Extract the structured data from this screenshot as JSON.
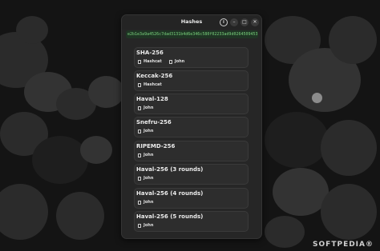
{
  "window": {
    "title": "Hashes"
  },
  "controls": {
    "info": "i",
    "minimize": "–",
    "maximize": "□",
    "close": "✕"
  },
  "hash_value": "e2b1e3a9a4526c7dad3131b4d6e346c580f02233ad9d0264509453",
  "results": [
    {
      "algorithm": "SHA-256",
      "tools": [
        "Hashcat",
        "John"
      ]
    },
    {
      "algorithm": "Keccak-256",
      "tools": [
        "Hashcat"
      ]
    },
    {
      "algorithm": "Haval-128",
      "tools": [
        "John"
      ]
    },
    {
      "algorithm": "Snefru-256",
      "tools": [
        "John"
      ]
    },
    {
      "algorithm": "RIPEMD-256",
      "tools": [
        "John"
      ]
    },
    {
      "algorithm": "Haval-256 (3 rounds)",
      "tools": [
        "John"
      ]
    },
    {
      "algorithm": "Haval-256 (4 rounds)",
      "tools": [
        "John"
      ]
    },
    {
      "algorithm": "Haval-256 (5 rounds)",
      "tools": [
        "John"
      ]
    }
  ],
  "watermark": "SOFTPEDIA®",
  "icons": {
    "tool": "terminal-icon"
  },
  "colors": {
    "window_bg": "#262626",
    "hash_text": "#79d17c",
    "hash_bg": "#1f3524"
  }
}
